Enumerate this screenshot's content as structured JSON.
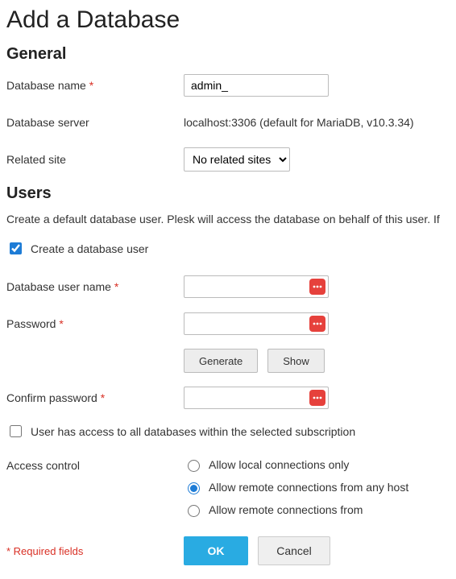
{
  "title": "Add a Database",
  "sections": {
    "general": {
      "heading": "General",
      "db_name_label": "Database name",
      "db_name_value": "admin_",
      "db_server_label": "Database server",
      "db_server_value": "localhost:3306 (default for MariaDB, v10.3.34)",
      "related_site_label": "Related site",
      "related_site_value": "No related sites"
    },
    "users": {
      "heading": "Users",
      "description": "Create a default database user. Plesk will access the database on behalf of this user. If",
      "create_user_label": "Create a database user",
      "create_user_checked": true,
      "db_user_label": "Database user name",
      "db_user_value": "",
      "password_label": "Password",
      "password_value": "",
      "generate_label": "Generate",
      "show_label": "Show",
      "confirm_password_label": "Confirm password",
      "confirm_password_value": "",
      "access_all_label": "User has access to all databases within the selected subscription",
      "access_all_checked": false,
      "access_control_label": "Access control",
      "access_options": [
        "Allow local connections only",
        "Allow remote connections from any host",
        "Allow remote connections from"
      ],
      "access_selected_index": 1
    }
  },
  "footer": {
    "required_note": "* Required fields",
    "ok_label": "OK",
    "cancel_label": "Cancel"
  }
}
